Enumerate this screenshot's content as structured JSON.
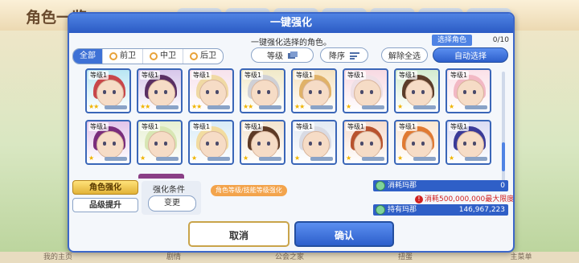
{
  "background": {
    "title": "角色一览",
    "bottom_nav": [
      "我的主页",
      "剧情",
      "公会之家",
      "扭蛋",
      "主菜单"
    ]
  },
  "dialog": {
    "title": "一键强化",
    "description": "一键强化选择的角色。",
    "selected_label": "选择角色",
    "selected_count": "0/10"
  },
  "filters": {
    "tabs": [
      {
        "label": "全部",
        "active": true
      },
      {
        "label": "前卫",
        "active": false
      },
      {
        "label": "中卫",
        "active": false
      },
      {
        "label": "后卫",
        "active": false
      }
    ],
    "sort_label": "等级",
    "order_label": "降序",
    "deselect_label": "解除全选",
    "auto_select_label": "自动选择"
  },
  "characters": [
    {
      "level": "等级1",
      "stars": "★★",
      "hair": "#c8474a",
      "bg": "#b9e6f3"
    },
    {
      "level": "等级1",
      "stars": "★★",
      "hair": "#5a2f63",
      "bg": "#d7c6ea"
    },
    {
      "level": "等级1",
      "stars": "★★",
      "hair": "#f0d9a4",
      "bg": "#f7e2ec"
    },
    {
      "level": "等级1",
      "stars": "★★",
      "hair": "#cfd0d6",
      "bg": "#f1e9c8"
    },
    {
      "level": "等级1",
      "stars": "★★",
      "hair": "#e0b268",
      "bg": "#f6e2bf"
    },
    {
      "level": "等级1",
      "stars": "★",
      "hair": "#efe0e6",
      "bg": "#f8d9e2"
    },
    {
      "level": "等级1",
      "stars": "★",
      "hair": "#5b3d2a",
      "bg": "#d4ecd0"
    },
    {
      "level": "等级1",
      "stars": "★",
      "hair": "#f2b8c4",
      "bg": "#fbe1e8"
    },
    {
      "level": "等级1",
      "stars": "★",
      "hair": "#7a2d7c",
      "bg": "#e3c5ea"
    },
    {
      "level": "等级1",
      "stars": "★",
      "hair": "#d8e6b4",
      "bg": "#e7f0d2"
    },
    {
      "level": "等级1",
      "stars": "★",
      "hair": "#f2dca0",
      "bg": "#d9ecf7"
    },
    {
      "level": "等级1",
      "stars": "★",
      "hair": "#5e3a26",
      "bg": "#f3e4cf"
    },
    {
      "level": "等级1",
      "stars": "★",
      "hair": "#d9dbe4",
      "bg": "#e3eaf3"
    },
    {
      "level": "等级1",
      "stars": "★",
      "hair": "#b8532e",
      "bg": "#f6dccd"
    },
    {
      "level": "等级1",
      "stars": "★",
      "hair": "#e07a32",
      "bg": "#fbe6d1"
    },
    {
      "level": "等级1",
      "stars": "★",
      "hair": "#3a3a98",
      "bg": "#dadcf4"
    }
  ],
  "side_buttons": {
    "enhance_label": "角色强化",
    "upgrade_label": "品级提升"
  },
  "condition": {
    "label": "强化条件",
    "change_label": "变更",
    "tag": "角色等级/技能等级强化"
  },
  "materials": {
    "cost_label": "消耗玛那",
    "cost_value": "0",
    "warning": "消耗500,000,000最大限度",
    "owned_label": "持有玛那",
    "owned_value": "146,967,223"
  },
  "footer": {
    "cancel_label": "取消",
    "confirm_label": "确认"
  }
}
